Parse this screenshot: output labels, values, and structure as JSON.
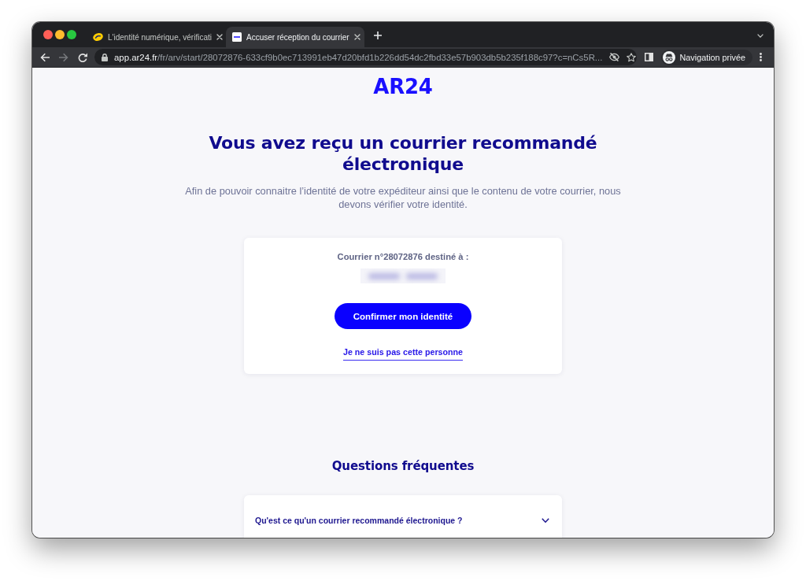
{
  "browser": {
    "tabs": [
      {
        "title": "L'identité numérique, vérificati",
        "selected": false
      },
      {
        "title": "Accuser réception du courrier",
        "selected": true
      }
    ],
    "nav_buttons": [
      {
        "kind": "back",
        "disabled": false
      },
      {
        "kind": "forward",
        "disabled": true
      },
      {
        "kind": "reload",
        "disabled": false
      }
    ],
    "address": {
      "host": "app.ar24.fr",
      "path": "/fr/arv/start/28072876-633cf9b0ec713991eb47d20bfd1b226dd54dc2fbd33e57b903db5b235f188c97?c=nCs5R..."
    },
    "profile": {
      "label": "Navigation privée"
    }
  },
  "page": {
    "logo": "AR24",
    "title": "Vous avez reçu un courrier recommandé électronique",
    "intro": "Afin de pouvoir connaitre l’identité de votre expéditeur ainsi que le contenu de votre courrier, nous devons vérifier votre identité.",
    "card": {
      "label": "Courrier n°28072876 destiné à :",
      "button": "Confirmer mon identité",
      "link": "Je ne suis pas cette personne"
    },
    "faq": {
      "title": "Questions fréquentes",
      "items": [
        {
          "question": "Qu'est ce qu'un courrier recommandé électronique ?",
          "expanded": false
        }
      ]
    }
  }
}
